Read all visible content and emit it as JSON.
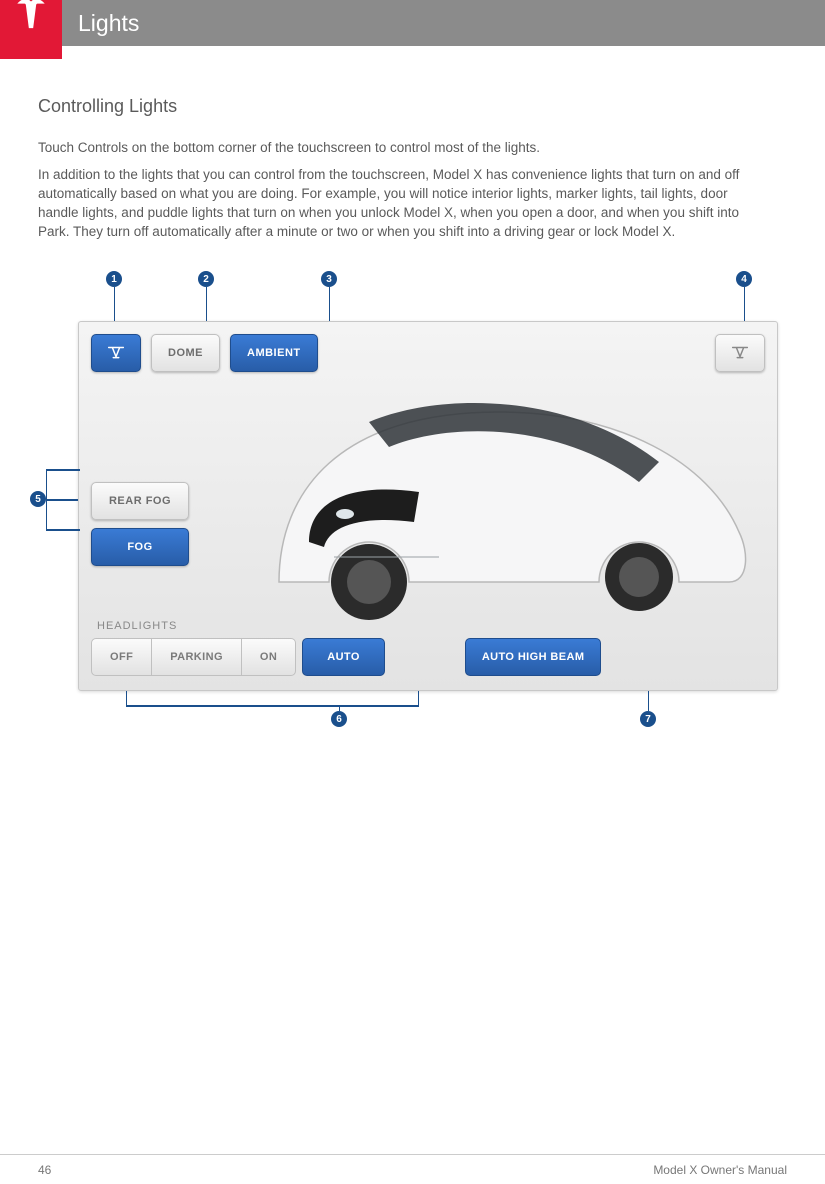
{
  "header": {
    "title": "Lights"
  },
  "section": {
    "heading": "Controlling Lights",
    "p1": "Touch Controls on the bottom corner of the touchscreen to control most of the lights.",
    "p2": "In addition to the lights that you can control from the touchscreen, Model X has convenience lights that turn on and off automatically based on what you are doing. For example, you will notice interior lights, marker lights, tail lights, door handle lights, and puddle lights that turn on when you unlock Model X, when you open a door, and when you shift into Park. They turn off automatically after a minute or two or when you shift into a driving gear or lock Model X."
  },
  "callouts": {
    "c1": "1",
    "c2": "2",
    "c3": "3",
    "c4": "4",
    "c5": "5",
    "c6": "6",
    "c7": "7"
  },
  "panel": {
    "dome": "DOME",
    "ambient": "AMBIENT",
    "rearfog": "REAR FOG",
    "fog": "FOG",
    "headlights_label": "HEADLIGHTS",
    "seg_off": "OFF",
    "seg_parking": "PARKING",
    "seg_on": "ON",
    "seg_auto": "AUTO",
    "ahb": "AUTO HIGH BEAM"
  },
  "footer": {
    "page": "46",
    "book": "Model X Owner's Manual"
  }
}
